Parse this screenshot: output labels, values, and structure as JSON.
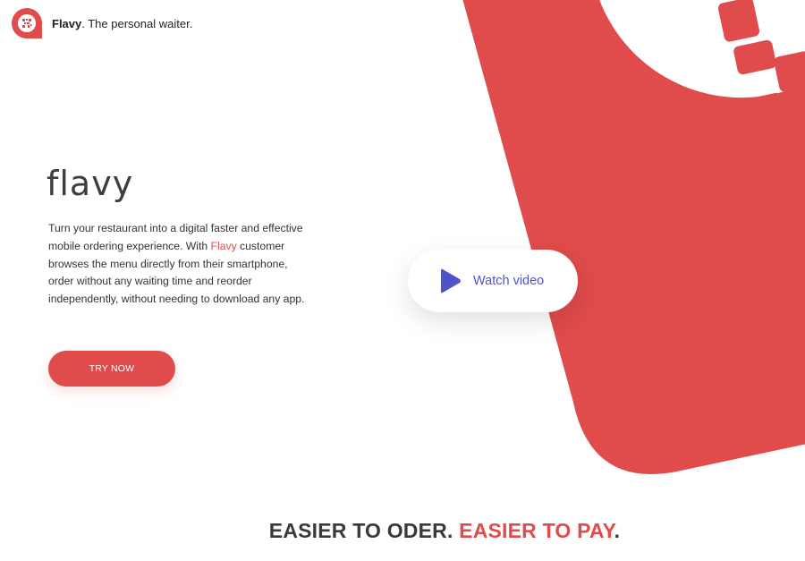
{
  "header": {
    "brand": "Flavy",
    "tagline": ". The personal waiter."
  },
  "hero": {
    "logo_text": "flavy",
    "paragraph_before": "Turn your restaurant into a digital faster and effective mobile ordering experience. With ",
    "paragraph_accent": "Flavy",
    "paragraph_after": " customer browses the menu directly from their smartphone, order without any waiting time and reorder independently, without needing to download any app.",
    "cta_label": "TRY NOW"
  },
  "video": {
    "label": "Watch video",
    "icon": "play-icon"
  },
  "tagline": {
    "part1": "EASIER TO ODER. ",
    "part2": "EASIER TO PAY",
    "part3": "."
  },
  "colors": {
    "accent": "#e04b4b",
    "video_accent": "#4e54c8",
    "text": "#3a3a3a"
  }
}
